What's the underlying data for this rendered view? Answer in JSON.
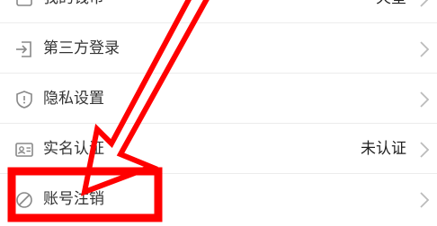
{
  "settings": {
    "rows": [
      {
        "label": "我的钱币",
        "value": "火星",
        "icon": "wallet-icon"
      },
      {
        "label": "第三方登录",
        "value": "",
        "icon": "login-icon"
      },
      {
        "label": "隐私设置",
        "value": "",
        "icon": "shield-icon"
      },
      {
        "label": "实名认证",
        "value": "未认证",
        "icon": "id-card-icon"
      },
      {
        "label": "账号注销",
        "value": "",
        "icon": "cancel-icon"
      }
    ]
  },
  "annotation": {
    "color": "#ff0000",
    "target": "账号注销"
  }
}
